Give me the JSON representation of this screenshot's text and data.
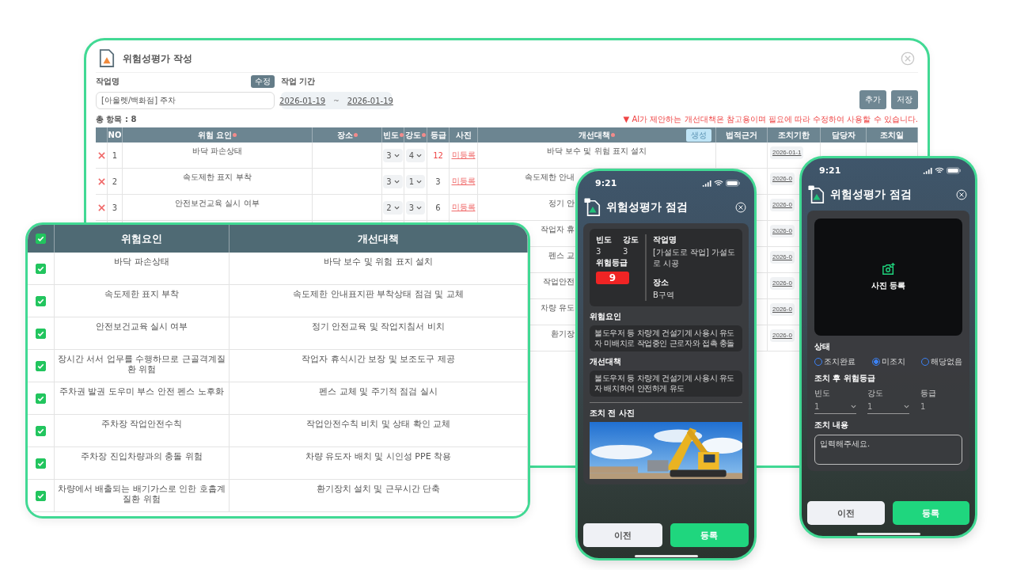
{
  "back_window": {
    "title": "위험성평가 작성",
    "job_label": "작업명",
    "edit_button": "수정",
    "period_label": "작업 기간",
    "job_name": "[아울렛/백화점] 주차",
    "date_from": "2026-01-19",
    "date_sep": "~",
    "date_to": "2026-01-19",
    "buttons": [
      "추가",
      "저장"
    ],
    "total": "총 항목 : 8",
    "notice_mark": "▼",
    "notice": "AI가 제안하는 개선대책은 참고용이며 필요에 따라 수정하여 사용할 수 있습니다.",
    "table": {
      "columns": [
        {
          "label": "NO",
          "required": false
        },
        {
          "label": "위험 요인",
          "required": true
        },
        {
          "label": "장소",
          "required": true
        },
        {
          "label": "빈도",
          "required": true
        },
        {
          "label": "강도",
          "required": true
        },
        {
          "label": "등급",
          "required": false
        },
        {
          "label": "사진",
          "required": false
        },
        {
          "label": "개선대책",
          "required": true,
          "button": "생성"
        },
        {
          "label": "법적근거",
          "required": false
        },
        {
          "label": "조치기한",
          "required": false
        },
        {
          "label": "담당자",
          "required": false
        },
        {
          "label": "조치일",
          "required": false
        }
      ],
      "rows": [
        {
          "no": "1",
          "hazard": "바닥 파손상태",
          "frequency": "3",
          "severity": "4",
          "grade": "12",
          "high_risk": true,
          "photo": "미등록",
          "measure": "바닥 보수 및 위험 표지 설치",
          "deadline": "2026-01-1"
        },
        {
          "no": "2",
          "hazard": "속도제한 표지 부착",
          "frequency": "3",
          "severity": "1",
          "grade": "3",
          "high_risk": false,
          "photo": "미등록",
          "measure": "속도제한 안내",
          "deadline": "2026-0"
        },
        {
          "no": "3",
          "hazard": "안전보건교육 실시 여부",
          "frequency": "2",
          "severity": "3",
          "grade": "6",
          "high_risk": false,
          "photo": "미등록",
          "measure": "정기 안",
          "deadline": "2026-0"
        },
        {
          "measure": "작업자 휴",
          "deadline": "2026-0"
        },
        {
          "measure": "펜스 교",
          "deadline": "2026-0"
        },
        {
          "measure": "작업안전",
          "deadline": "2026-0"
        },
        {
          "measure": "차량 유도",
          "deadline": "2026-0"
        },
        {
          "measure": "환기장",
          "deadline": "2026-0"
        }
      ]
    }
  },
  "front_card": {
    "header_checked": true,
    "columns": [
      "위험요인",
      "개선대책"
    ],
    "rows": [
      {
        "checked": true,
        "hazard": "바닥 파손상태",
        "measure": "바닥 보수 및 위험 표지 설치"
      },
      {
        "checked": true,
        "hazard": "속도제한 표지 부착",
        "measure": "속도제한 안내표지판 부착상태 점검 및 교체"
      },
      {
        "checked": true,
        "hazard": "안전보건교육 실시 여부",
        "measure": "정기 안전교육 및 작업지침서 비치"
      },
      {
        "checked": true,
        "hazard": "장시간 서서 업무를 수행하므로 근골격계질환 위험",
        "measure": "작업자 휴식시간 보장 및 보조도구 제공"
      },
      {
        "checked": true,
        "hazard": "주차권 발권 도우미 부스 안전 펜스 노후화",
        "measure": "펜스 교체 및 주기적 점검 실시"
      },
      {
        "checked": true,
        "hazard": "주차장 작업안전수칙",
        "measure": "작업안전수칙 비치 및 상태 확인 교체"
      },
      {
        "checked": true,
        "hazard": "주차장 진입차량과의 충돌 위험",
        "measure": "차량 유도자 배치 및 시인성 PPE 착용"
      },
      {
        "checked": true,
        "hazard": "차량에서 배출되는 배기가스로  인한 호흡계질환 위험",
        "measure": "환기장치 설치 및 근무시간 단축"
      }
    ]
  },
  "phone_inspection": {
    "time": "9:21",
    "title": "위험성평가 점검",
    "frequency_label": "빈도",
    "frequency": "3",
    "severity_label": "강도",
    "severity": "3",
    "grade_label": "위험등급",
    "grade": "9",
    "job_label": "작업명",
    "job": "[가설도로 작업] 가설도로 시공",
    "place_label": "장소",
    "place": "B구역",
    "hazard_label": "위험요인",
    "hazard": "불도우저 등 차량계 건설기계 사용시 유도자 미배치로 작업중인 근로자와 접촉 충돌",
    "measure_label": "개선대책",
    "measure": "불도우저 등 차량계 건설기계 사용시 유도자 배치하여 안전하게 유도",
    "photo_label": "조치 전 사진",
    "buttons": [
      {
        "label": "이전",
        "kind": "secondary"
      },
      {
        "label": "등록",
        "kind": "primary"
      }
    ]
  },
  "phone_action": {
    "time": "9:21",
    "title": "위험성평가 점검",
    "photo_button": "사진 등록",
    "status_label": "상태",
    "statuses": [
      {
        "label": "조치완료",
        "selected": false
      },
      {
        "label": "미조치",
        "selected": true
      },
      {
        "label": "해당없음",
        "selected": false
      }
    ],
    "after_label": "조치 후 위험등급",
    "fields": [
      {
        "label": "빈도",
        "value": "1",
        "kind": "select"
      },
      {
        "label": "강도",
        "value": "1",
        "kind": "select"
      },
      {
        "label": "등급",
        "value": "1",
        "kind": "text"
      }
    ],
    "note_label": "조치 내용",
    "note_placeholder": "입력해주세요.",
    "buttons": [
      {
        "label": "이전",
        "kind": "secondary"
      },
      {
        "label": "등록",
        "kind": "primary"
      }
    ]
  }
}
